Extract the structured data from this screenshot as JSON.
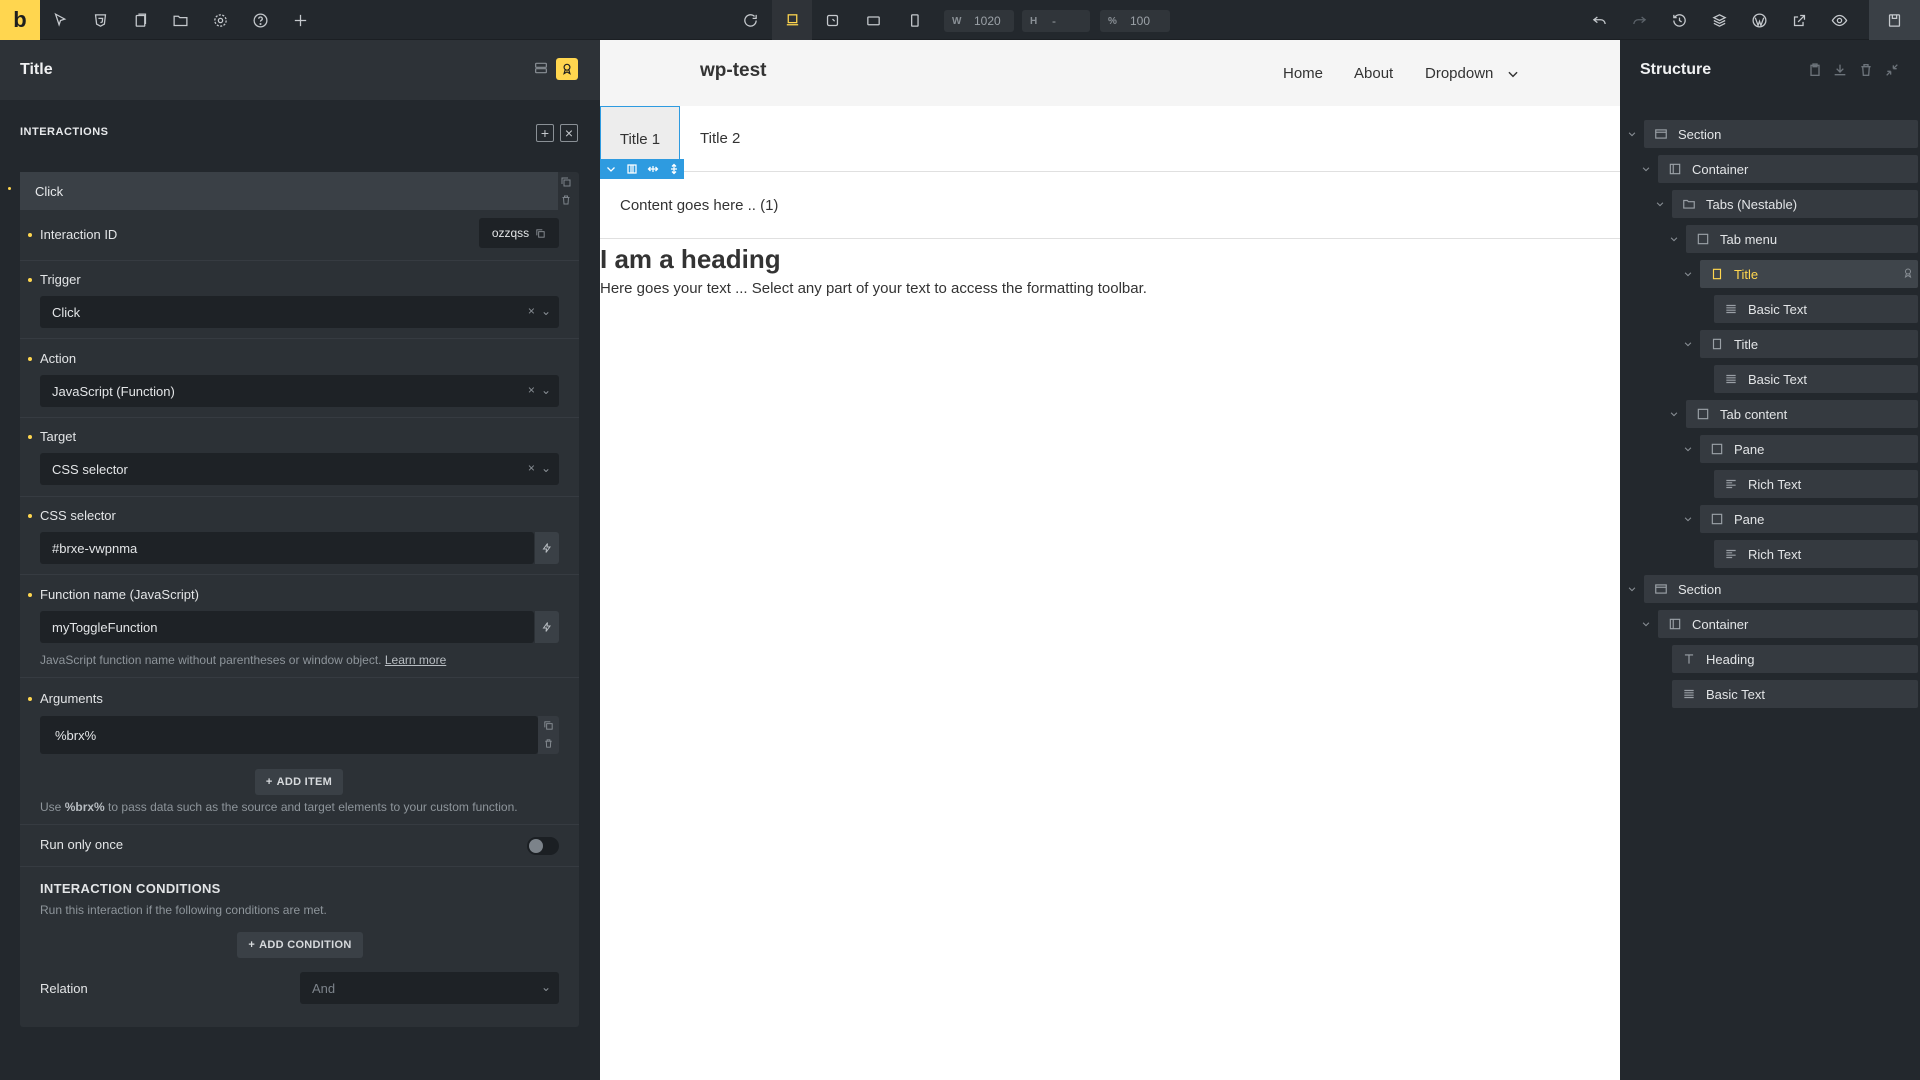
{
  "app": {
    "logo_letter": "b",
    "viewport": {
      "w_label": "W",
      "w_value": "1020",
      "h_label": "H",
      "h_value": "-",
      "zoom_label": "%",
      "zoom_value": "100"
    }
  },
  "left_panel": {
    "title": "Title",
    "section_title": "INTERACTIONS",
    "interaction": {
      "header": "Click",
      "id_label": "Interaction ID",
      "id_value": "ozzqss",
      "trigger_label": "Trigger",
      "trigger_value": "Click",
      "action_label": "Action",
      "action_value": "JavaScript (Function)",
      "target_label": "Target",
      "target_value": "CSS selector",
      "css_selector_label": "CSS selector",
      "css_selector_value": "#brxe-vwpnma",
      "function_name_label": "Function name (JavaScript)",
      "function_name_value": "myToggleFunction",
      "function_help": "JavaScript function name without parentheses or window object.",
      "learn_more": "Learn more",
      "arguments_label": "Arguments",
      "argument_value": "%brx%",
      "add_item": "ADD ITEM",
      "arguments_help_pre": "Use",
      "arguments_help_code": "%brx%",
      "arguments_help_post": "to pass data such as the source and target elements to your custom function.",
      "run_once_label": "Run only once",
      "run_once_on": false,
      "conditions_title": "INTERACTION CONDITIONS",
      "conditions_help": "Run this interaction if the following conditions are met.",
      "add_condition": "ADD CONDITION",
      "relation_label": "Relation",
      "relation_value": "And"
    }
  },
  "canvas": {
    "site_title": "wp-test",
    "nav": [
      "Home",
      "About",
      "Dropdown"
    ],
    "tabs": [
      "Title 1",
      "Title 2"
    ],
    "content": "Content goes here .. (1)",
    "heading": "I am a heading",
    "text": "Here goes your text ... Select any part of your text to access the formatting toolbar."
  },
  "structure": {
    "title": "Structure",
    "nodes": [
      "Section",
      "Container",
      "Tabs (Nestable)",
      "Tab menu",
      "Title",
      "Basic Text",
      "Title",
      "Basic Text",
      "Tab content",
      "Pane",
      "Rich Text",
      "Pane",
      "Rich Text",
      "Section",
      "Container",
      "Heading",
      "Basic Text"
    ]
  },
  "colors": {
    "accent": "#ffd64f",
    "selection": "#2e9be0",
    "panel": "#23282d"
  }
}
